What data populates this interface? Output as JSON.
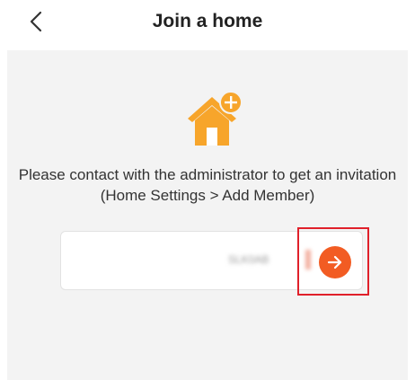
{
  "header": {
    "title": "Join a home",
    "back_icon": "chevron-left-icon"
  },
  "main": {
    "house_icon": "house-plus-icon",
    "instructions": "Please contact with the administrator to get an invitation (Home Settings > Add Member)",
    "invitation_code": {
      "value": "SLK0AB"
    },
    "submit_icon": "arrow-right-icon"
  },
  "colors": {
    "accent_orange": "#f25c23",
    "house_orange": "#f7a52b",
    "highlight_red": "#e0202a",
    "panel_bg": "#f3f3f3"
  }
}
